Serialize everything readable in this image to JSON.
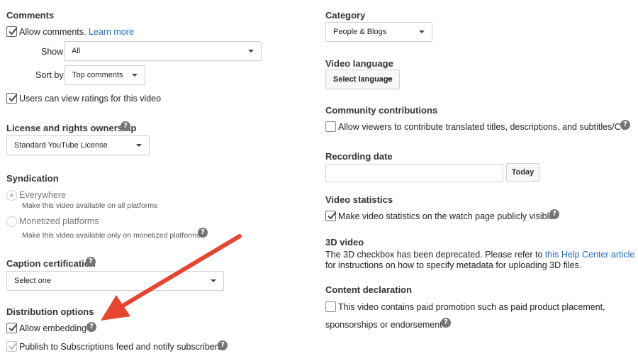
{
  "comments": {
    "heading": "Comments",
    "allow_label": "Allow comments.",
    "learn_more": "Learn more",
    "show_label": "Show",
    "show_value": "All",
    "sortby_label": "Sort by",
    "sortby_value": "Top comments",
    "ratings_label": "Users can view ratings for this video"
  },
  "license": {
    "heading": "License and rights ownership",
    "value": "Standard YouTube License"
  },
  "syndication": {
    "heading": "Syndication",
    "everywhere_label": "Everywhere",
    "everywhere_desc": "Make this video available on all platforms",
    "monetized_label": "Monetized platforms",
    "monetized_desc": "Make this video available only on monetized platforms"
  },
  "caption": {
    "heading": "Caption certification",
    "value": "Select one"
  },
  "distribution": {
    "heading": "Distribution options",
    "embedding_label": "Allow embedding",
    "publish_label": "Publish to Subscriptions feed and notify subscribers"
  },
  "category": {
    "heading": "Category",
    "value": "People & Blogs"
  },
  "language": {
    "heading": "Video language",
    "value": "Select language"
  },
  "community": {
    "heading": "Community contributions",
    "label": "Allow viewers to contribute translated titles, descriptions, and subtitles/CC"
  },
  "recording": {
    "heading": "Recording date",
    "date_value": "",
    "today_label": "Today"
  },
  "stats": {
    "heading": "Video statistics",
    "label": "Make video statistics on the watch page publicly visible"
  },
  "video3d": {
    "heading": "3D video",
    "text_before": "The 3D checkbox has been deprecated. Please refer to ",
    "link": "this Help Center article",
    "text_after": "for instructions on how to specify metadata for uploading 3D files."
  },
  "content": {
    "heading": "Content declaration",
    "line1": "This video contains paid promotion such as paid product placement,",
    "line2": "sponsorships or endorsement"
  },
  "icons": {
    "check": "check-icon",
    "help": "help-circle-icon",
    "caret": "caret-down-icon",
    "annotation": "red-arrow-annotation"
  },
  "colors": {
    "link": "#2167c7",
    "arrow": "#e8452f",
    "help_icon": "#757575"
  }
}
